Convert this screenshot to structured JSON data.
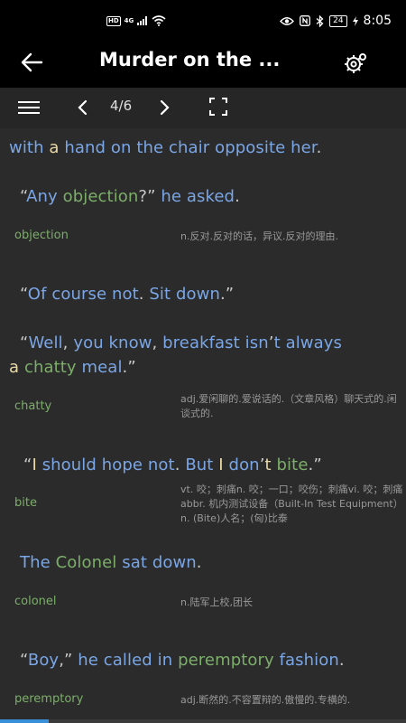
{
  "status_bar": {
    "left": {
      "hd": "HD",
      "network": "4G"
    },
    "right": {
      "battery": "24",
      "time": "8:05"
    }
  },
  "app_bar": {
    "title": "Murder on the ..."
  },
  "toolbar": {
    "page": "4/6"
  },
  "content": {
    "sentences": [
      {
        "id": "s1",
        "tokens": [
          {
            "t": "with",
            "c": "w"
          },
          {
            "t": " "
          },
          {
            "t": "a",
            "c": "y"
          },
          {
            "t": " "
          },
          {
            "t": "hand",
            "c": "w"
          },
          {
            "t": " "
          },
          {
            "t": "on",
            "c": "w"
          },
          {
            "t": " "
          },
          {
            "t": "the",
            "c": "w"
          },
          {
            "t": " "
          },
          {
            "t": "chair",
            "c": "w"
          },
          {
            "t": " "
          },
          {
            "t": "opposite",
            "c": "w"
          },
          {
            "t": " "
          },
          {
            "t": "her",
            "c": "w"
          },
          {
            "t": ".",
            "c": "p"
          }
        ]
      },
      {
        "id": "s2",
        "tokens": [
          {
            "t": "“",
            "c": "p"
          },
          {
            "t": "Any",
            "c": "w"
          },
          {
            "t": " "
          },
          {
            "t": "objection",
            "c": "v"
          },
          {
            "t": "?”",
            "c": "p"
          },
          {
            "t": " "
          },
          {
            "t": "he",
            "c": "w"
          },
          {
            "t": " "
          },
          {
            "t": "asked",
            "c": "w"
          },
          {
            "t": ".",
            "c": "p"
          }
        ]
      },
      {
        "id": "s3",
        "tokens": [
          {
            "t": "“",
            "c": "p"
          },
          {
            "t": "Of",
            "c": "w"
          },
          {
            "t": " "
          },
          {
            "t": "course",
            "c": "w"
          },
          {
            "t": " "
          },
          {
            "t": "not",
            "c": "w"
          },
          {
            "t": ".",
            "c": "p"
          },
          {
            "t": " "
          },
          {
            "t": "Sit",
            "c": "w"
          },
          {
            "t": " "
          },
          {
            "t": "down",
            "c": "w"
          },
          {
            "t": ".”",
            "c": "p"
          }
        ]
      },
      {
        "id": "s4a",
        "tokens": [
          {
            "t": "“",
            "c": "p"
          },
          {
            "t": "Well",
            "c": "w"
          },
          {
            "t": ",",
            "c": "p"
          },
          {
            "t": " "
          },
          {
            "t": "you",
            "c": "w"
          },
          {
            "t": " "
          },
          {
            "t": "know",
            "c": "w"
          },
          {
            "t": ",",
            "c": "p"
          },
          {
            "t": " "
          },
          {
            "t": "breakfast",
            "c": "w"
          },
          {
            "t": " "
          },
          {
            "t": "isn",
            "c": "w"
          },
          {
            "t": "’",
            "c": "p"
          },
          {
            "t": "t",
            "c": "w"
          },
          {
            "t": " "
          },
          {
            "t": "always",
            "c": "w"
          }
        ]
      },
      {
        "id": "s4b",
        "tokens": [
          {
            "t": "a",
            "c": "y"
          },
          {
            "t": " "
          },
          {
            "t": "chatty",
            "c": "v"
          },
          {
            "t": " "
          },
          {
            "t": "meal",
            "c": "w"
          },
          {
            "t": ".”",
            "c": "p"
          }
        ]
      },
      {
        "id": "s5",
        "tokens": [
          {
            "t": "“",
            "c": "p"
          },
          {
            "t": "I",
            "c": "y"
          },
          {
            "t": " "
          },
          {
            "t": "should",
            "c": "w"
          },
          {
            "t": " "
          },
          {
            "t": "hope",
            "c": "w"
          },
          {
            "t": " "
          },
          {
            "t": "not",
            "c": "w"
          },
          {
            "t": ".",
            "c": "p"
          },
          {
            "t": " "
          },
          {
            "t": "But",
            "c": "w"
          },
          {
            "t": " "
          },
          {
            "t": "I",
            "c": "y"
          },
          {
            "t": " "
          },
          {
            "t": "don",
            "c": "w"
          },
          {
            "t": "’",
            "c": "p"
          },
          {
            "t": "t",
            "c": "y"
          },
          {
            "t": " "
          },
          {
            "t": "bite",
            "c": "v"
          },
          {
            "t": ".”",
            "c": "p"
          }
        ]
      },
      {
        "id": "s6",
        "tokens": [
          {
            "t": "The",
            "c": "w"
          },
          {
            "t": " "
          },
          {
            "t": "Colonel",
            "c": "v"
          },
          {
            "t": " "
          },
          {
            "t": "sat",
            "c": "w"
          },
          {
            "t": " "
          },
          {
            "t": "down",
            "c": "w"
          },
          {
            "t": ".",
            "c": "p"
          }
        ]
      },
      {
        "id": "s7",
        "tokens": [
          {
            "t": "“",
            "c": "p"
          },
          {
            "t": "Boy",
            "c": "w"
          },
          {
            "t": ",”",
            "c": "p"
          },
          {
            "t": " "
          },
          {
            "t": "he",
            "c": "w"
          },
          {
            "t": " "
          },
          {
            "t": "called",
            "c": "w"
          },
          {
            "t": " "
          },
          {
            "t": "in",
            "c": "w"
          },
          {
            "t": " "
          },
          {
            "t": "peremptory",
            "c": "v"
          },
          {
            "t": " "
          },
          {
            "t": "fashion",
            "c": "w"
          },
          {
            "t": ".",
            "c": "p"
          }
        ]
      }
    ],
    "glosses": [
      {
        "word": "objection",
        "def": "n.反对.反对的话，异议.反对的理由."
      },
      {
        "word": "chatty",
        "def": "adj.爱闲聊的.爱说话的.（文章风格）聊天式的.闲谈式的."
      },
      {
        "word": "bite",
        "def": "vt. 咬；刺痛n. 咬；一口；咬伤；刺痛vi. 咬；刺痛abbr. 机内测试设备（Built-In Test Equipment）n. (Bite)人名；(匈)比泰"
      },
      {
        "word": "colonel",
        "def": "n.陆军上校,团长"
      },
      {
        "word": "peremptory",
        "def": "adj.断然的.不容置辩的.傲慢的.专横的."
      }
    ]
  },
  "progress": {
    "value": 0.12
  },
  "colors": {
    "accent": "#3a8fd9",
    "word": "#7aa6e6",
    "vocab": "#7cae6a",
    "background": "#2b2b2b"
  }
}
